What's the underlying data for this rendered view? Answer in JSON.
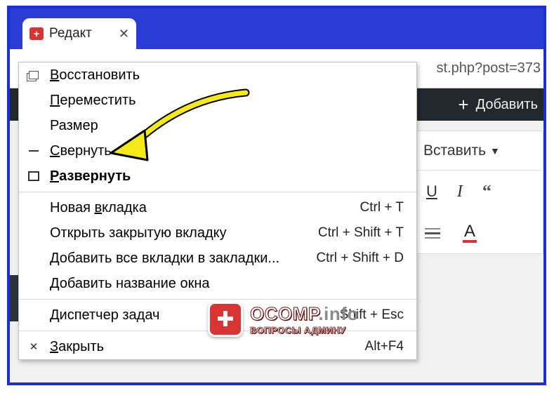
{
  "tab": {
    "title": "Редакт",
    "close": "✕"
  },
  "url_fragment": "st.php?post=373",
  "adminbar": {
    "add_label": "Добавить"
  },
  "editor": {
    "insert_label": "Вставить",
    "toolbar": {
      "underline": "U",
      "italic": "I",
      "quote": "“",
      "textcolor": "A"
    }
  },
  "context_menu": {
    "restore": "Восстановить",
    "move": "Переместить",
    "size": "Размер",
    "minimize": "Свернуть",
    "maximize": "Развернуть",
    "new_tab": {
      "label": "Новая вкладка",
      "shortcut": "Ctrl + T"
    },
    "reopen_tab": {
      "label": "Открыть закрытую вкладку",
      "shortcut": "Ctrl + Shift + T"
    },
    "bookmark_all": {
      "label": "Добавить все вкладки в закладки...",
      "shortcut": "Ctrl + Shift + D"
    },
    "name_window": "Добавить название окна",
    "task_manager": {
      "label": "Диспетчер задач",
      "shortcut": "Shift + Esc"
    },
    "close": {
      "label": "Закрыть",
      "shortcut": "Alt+F4"
    }
  },
  "watermark": {
    "brand": "OCOMP",
    "suffix": ".info",
    "subtitle": "ВОПРОСЫ АДМИНУ"
  }
}
